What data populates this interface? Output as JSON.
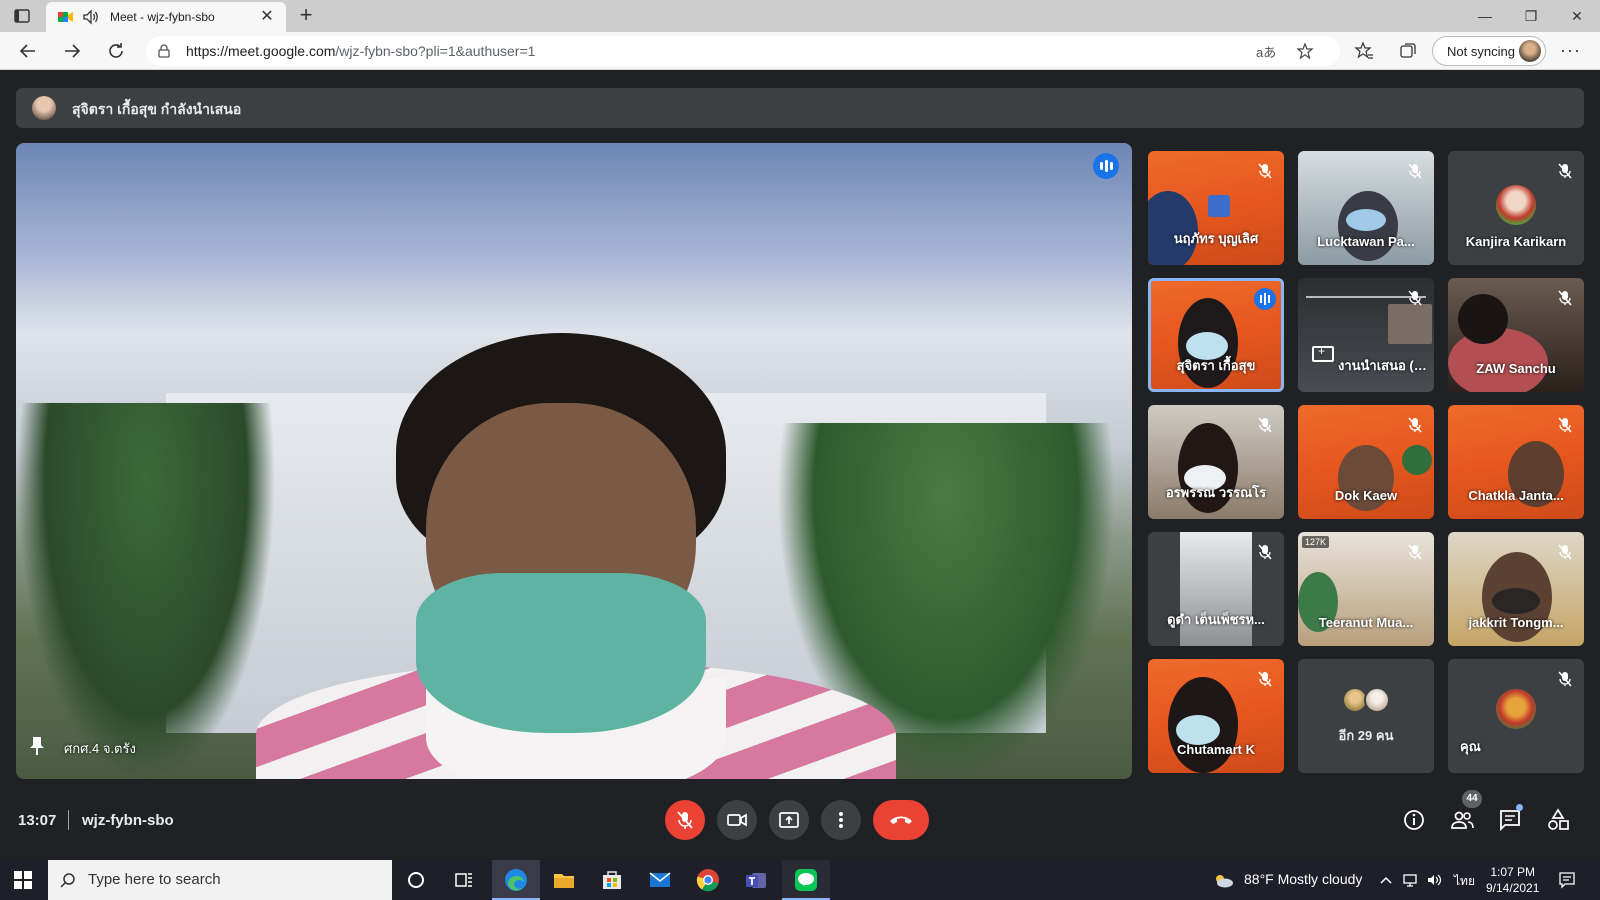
{
  "browser": {
    "tab_title": "Meet - wjz-fybn-sbo",
    "url_host": "https://meet.google.com",
    "url_path": "/wjz-fybn-sbo?pli=1&authuser=1",
    "sync_label": "Not syncing",
    "read_aloud_label": "aあ"
  },
  "meet": {
    "presenting_banner": "สุจิตรา เกื้อสุข กำลังนำเสนอ",
    "main_video_label": "ศกศ.4 จ.ตรัง",
    "tiles": [
      {
        "name": "นฤภัทร บุญเลิศ",
        "muted": true
      },
      {
        "name": "Lucktawan Pa...",
        "muted": true
      },
      {
        "name": "Kanjira Karikarn",
        "muted": true
      },
      {
        "name": "สุจิตรา เกื้อสุข",
        "muted": false,
        "speaking": true
      },
      {
        "name": "งานนำเสนอ (สุจิตรา เกื้...",
        "muted": true
      },
      {
        "name": "ZAW Sanchu",
        "muted": true
      },
      {
        "name": "อรพรรณ วรรณโร",
        "muted": true
      },
      {
        "name": "Dok Kaew",
        "muted": true
      },
      {
        "name": "Chatkla Janta...",
        "muted": true
      },
      {
        "name": "ดูดำ เต็นเพ็ชรห...",
        "muted": true
      },
      {
        "name": "Teeranut Mua...",
        "muted": true
      },
      {
        "name": "jakkrit Tongm...",
        "muted": true
      },
      {
        "name": "Chutamart K",
        "muted": true
      },
      {
        "name": "อีก 29 คน",
        "muted": false
      },
      {
        "name": "คุณ",
        "muted": true
      }
    ],
    "tile_live_badge": "127K",
    "time": "13:07",
    "meeting_code": "wjz-fybn-sbo",
    "participant_count": "44"
  },
  "taskbar": {
    "search_placeholder": "Type here to search",
    "weather": "88°F  Mostly cloudy",
    "language": "ไทย",
    "time": "1:07 PM",
    "date": "9/14/2021"
  },
  "colors": {
    "meet_bg": "#202124",
    "end_call_red": "#ea4335",
    "speaking_blue": "#1a73e8"
  }
}
